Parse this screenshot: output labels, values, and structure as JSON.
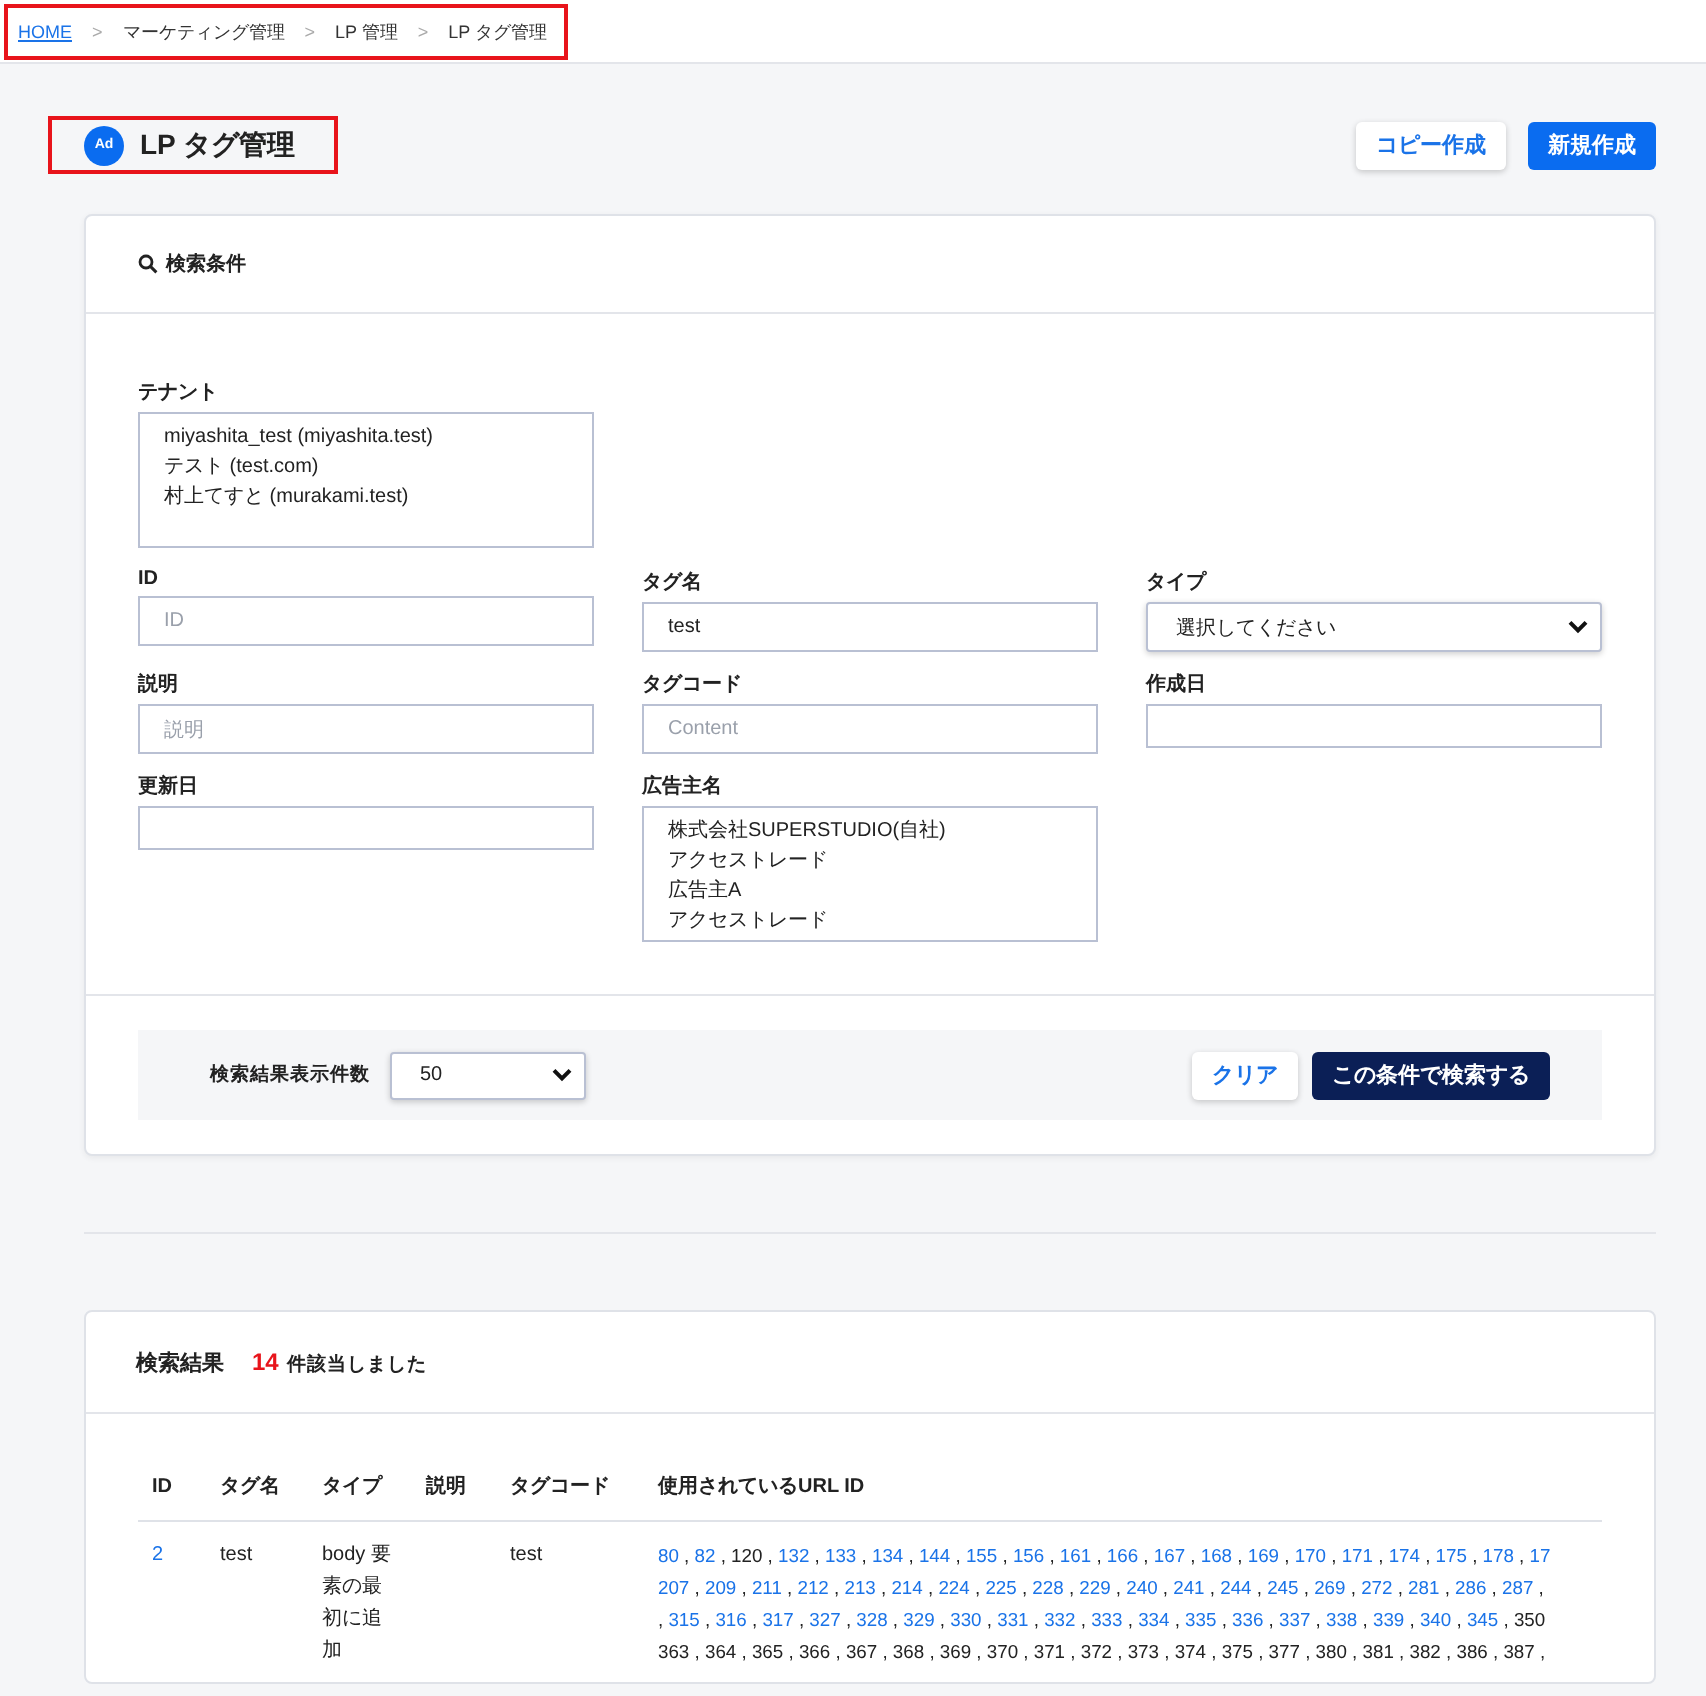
{
  "breadcrumb": [
    {
      "label": "HOME",
      "link": true
    },
    {
      "label": "マーケティング管理",
      "link": false,
      "separator": ">"
    },
    {
      "label": "LP 管理",
      "link": false,
      "separator": ">"
    },
    {
      "label": "LP タグ管理",
      "link": false,
      "separator": ">"
    }
  ],
  "title_icon_text": "Ad",
  "page_title": "LP タグ管理",
  "header_buttons": [
    {
      "label": "コピー作成",
      "kind": "secondary"
    },
    {
      "label": "新規作成",
      "kind": "primary"
    }
  ],
  "search": {
    "title": "検索条件",
    "tenant": {
      "label": "テナント",
      "options": [
        "miyashita_test (miyashita.test)",
        "テスト (test.com)",
        "村上てすと (murakami.test)"
      ]
    },
    "fields": [
      {
        "label": "ID",
        "kind": "text",
        "placeholder": "ID"
      },
      {
        "label": "タグ名",
        "kind": "text",
        "value": "test"
      },
      {
        "label": "タイプ",
        "kind": "select",
        "value": "選択してください"
      },
      {
        "label": "説明",
        "kind": "text",
        "placeholder": "説明"
      },
      {
        "label": "タグコード",
        "kind": "text",
        "placeholder": "Content"
      },
      {
        "label": "作成日",
        "kind": "date"
      },
      {
        "label": "更新日",
        "kind": "date"
      },
      {
        "label": "広告主名",
        "kind": "listbox",
        "options": [
          "株式会社SUPERSTUDIO(自社)",
          "アクセストレード",
          "広告主A",
          "アクセストレード"
        ]
      }
    ],
    "per_page": {
      "label": "検索結果表示件数",
      "value": "50"
    },
    "buttons": [
      {
        "label": "クリア",
        "kind": "secondary"
      },
      {
        "label": "この条件で検索する",
        "kind": "primary"
      }
    ]
  },
  "results": {
    "title": "検索結果",
    "count": "14",
    "count_suffix": "件該当しました",
    "table": {
      "columns": [
        "ID",
        "タグ名",
        "タイプ",
        "説明",
        "タグコード",
        "使用されているURL ID"
      ],
      "rows": [
        {
          "id": "2",
          "tag_name": "test",
          "type": "body 要素の最初に追加",
          "tag_code": "test",
          "url_id_lines": [
            {
              "ids": [
                {
                  "text": "80",
                  "link": true,
                  "comma": ","
                },
                {
                  "text": "82",
                  "link": true,
                  "comma": ","
                },
                {
                  "text": "120",
                  "link": false,
                  "comma": ","
                },
                {
                  "text": "132",
                  "link": true,
                  "comma": ","
                },
                {
                  "text": "133",
                  "link": true,
                  "comma": ","
                },
                {
                  "text": "134",
                  "link": true,
                  "comma": ","
                },
                {
                  "text": "144",
                  "link": true,
                  "comma": ","
                },
                {
                  "text": "155",
                  "link": true,
                  "comma": ","
                },
                {
                  "text": "156",
                  "link": true,
                  "comma": ","
                },
                {
                  "text": "161",
                  "link": true,
                  "comma": ","
                },
                {
                  "text": "166",
                  "link": true,
                  "comma": ","
                },
                {
                  "text": "167",
                  "link": true,
                  "comma": ","
                },
                {
                  "text": "168",
                  "link": true,
                  "comma": ","
                },
                {
                  "text": "169",
                  "link": true,
                  "comma": ","
                },
                {
                  "text": "170",
                  "link": true,
                  "comma": ","
                },
                {
                  "text": "171",
                  "link": true,
                  "comma": ","
                },
                {
                  "text": "174",
                  "link": true,
                  "comma": ","
                },
                {
                  "text": "175",
                  "link": true,
                  "comma": ","
                },
                {
                  "text": "178",
                  "link": true,
                  "comma": ","
                },
                {
                  "text": "17",
                  "link": true
                }
              ]
            },
            {
              "ids": [
                {
                  "text": "207",
                  "link": true,
                  "comma": ","
                },
                {
                  "text": "209",
                  "link": true,
                  "comma": ","
                },
                {
                  "text": "211",
                  "link": true,
                  "comma": ","
                },
                {
                  "text": "212",
                  "link": true,
                  "comma": ","
                },
                {
                  "text": "213",
                  "link": true,
                  "comma": ","
                },
                {
                  "text": "214",
                  "link": true,
                  "comma": ","
                },
                {
                  "text": "224",
                  "link": true,
                  "comma": ","
                },
                {
                  "text": "225",
                  "link": true,
                  "comma": ","
                },
                {
                  "text": "228",
                  "link": true,
                  "comma": ","
                },
                {
                  "text": "229",
                  "link": true,
                  "comma": ","
                },
                {
                  "text": "240",
                  "link": true,
                  "comma": ","
                },
                {
                  "text": "241",
                  "link": true,
                  "comma": ","
                },
                {
                  "text": "244",
                  "link": true,
                  "comma": ","
                },
                {
                  "text": "245",
                  "link": true,
                  "comma": ","
                },
                {
                  "text": "269",
                  "link": true,
                  "comma": ","
                },
                {
                  "text": "272",
                  "link": true,
                  "comma": ","
                },
                {
                  "text": "281",
                  "link": true,
                  "comma": ","
                },
                {
                  "text": "286",
                  "link": true,
                  "comma": ","
                },
                {
                  "text": "287",
                  "link": true,
                  "comma": ","
                }
              ]
            },
            {
              "prefix": ",",
              "ids": [
                {
                  "text": "315",
                  "link": true,
                  "comma": ","
                },
                {
                  "text": "316",
                  "link": true,
                  "comma": ","
                },
                {
                  "text": "317",
                  "link": true,
                  "comma": ","
                },
                {
                  "text": "327",
                  "link": true,
                  "comma": ","
                },
                {
                  "text": "328",
                  "link": true,
                  "comma": ","
                },
                {
                  "text": "329",
                  "link": true,
                  "comma": ","
                },
                {
                  "text": "330",
                  "link": true,
                  "comma": ","
                },
                {
                  "text": "331",
                  "link": true,
                  "comma": ","
                },
                {
                  "text": "332",
                  "link": true,
                  "comma": ","
                },
                {
                  "text": "333",
                  "link": true,
                  "comma": ","
                },
                {
                  "text": "334",
                  "link": true,
                  "comma": ","
                },
                {
                  "text": "335",
                  "link": true,
                  "comma": ","
                },
                {
                  "text": "336",
                  "link": true,
                  "comma": ","
                },
                {
                  "text": "337",
                  "link": true,
                  "comma": ","
                },
                {
                  "text": "338",
                  "link": true,
                  "comma": ","
                },
                {
                  "text": "339",
                  "link": true,
                  "comma": ","
                },
                {
                  "text": "340",
                  "link": true,
                  "comma": ","
                },
                {
                  "text": "345",
                  "link": true,
                  "comma": ","
                },
                {
                  "text": "350",
                  "link": false
                }
              ]
            },
            {
              "ids": [
                {
                  "text": "363",
                  "link": false,
                  "comma": ","
                },
                {
                  "text": "364",
                  "link": false,
                  "comma": ","
                },
                {
                  "text": "365",
                  "link": false,
                  "comma": ","
                },
                {
                  "text": "366",
                  "link": false,
                  "comma": ","
                },
                {
                  "text": "367",
                  "link": false,
                  "comma": ","
                },
                {
                  "text": "368",
                  "link": false,
                  "comma": ","
                },
                {
                  "text": "369",
                  "link": false,
                  "comma": ","
                },
                {
                  "text": "370",
                  "link": false,
                  "comma": ","
                },
                {
                  "text": "371",
                  "link": false,
                  "comma": ","
                },
                {
                  "text": "372",
                  "link": false,
                  "comma": ","
                },
                {
                  "text": "373",
                  "link": false,
                  "comma": ","
                },
                {
                  "text": "374",
                  "link": false,
                  "comma": ","
                },
                {
                  "text": "375",
                  "link": false,
                  "comma": ","
                },
                {
                  "text": "377",
                  "link": false,
                  "comma": ","
                },
                {
                  "text": "380",
                  "link": false,
                  "comma": ","
                },
                {
                  "text": "381",
                  "link": false,
                  "comma": ","
                },
                {
                  "text": "382",
                  "link": false,
                  "comma": ","
                },
                {
                  "text": "386",
                  "link": false,
                  "comma": ","
                },
                {
                  "text": "387",
                  "link": false,
                  "comma": ","
                }
              ]
            }
          ]
        }
      ]
    }
  }
}
